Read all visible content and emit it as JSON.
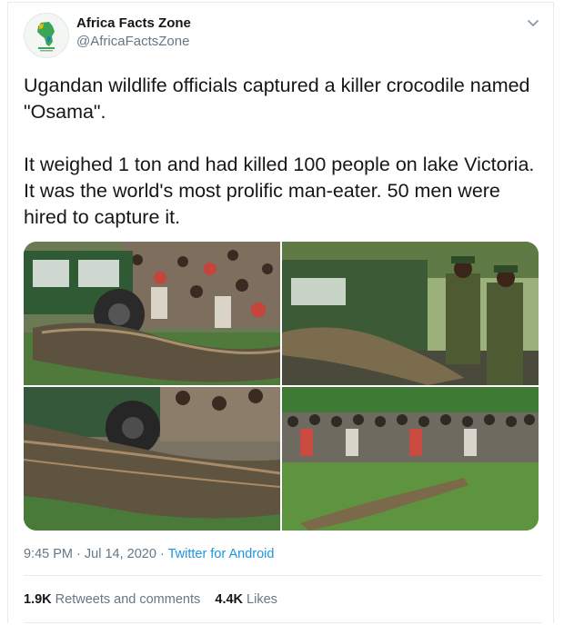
{
  "user": {
    "display_name": "Africa Facts Zone",
    "handle": "@AfricaFactsZone",
    "avatar_icon": "africa-map-logo-icon"
  },
  "tweet": {
    "paragraph_1": "Ugandan wildlife officials captured a killer crocodile named \"Osama\".",
    "paragraph_2": "It weighed 1 ton and had killed 100 people on lake Victoria. It was the world's most prolific man-eater. 50 men were hired to capture it."
  },
  "media": {
    "photo_count": 4
  },
  "meta": {
    "time": "9:45 PM",
    "date": "Jul 14, 2020",
    "dot": "·",
    "source": "Twitter for Android"
  },
  "stats": {
    "retweets_count": "1.9K",
    "retweets_label": "Retweets and comments",
    "likes_count": "4.4K",
    "likes_label": "Likes"
  },
  "colors": {
    "link": "#1b95e0",
    "muted": "#657786",
    "text": "#14171a",
    "border": "#e6ecf0"
  }
}
